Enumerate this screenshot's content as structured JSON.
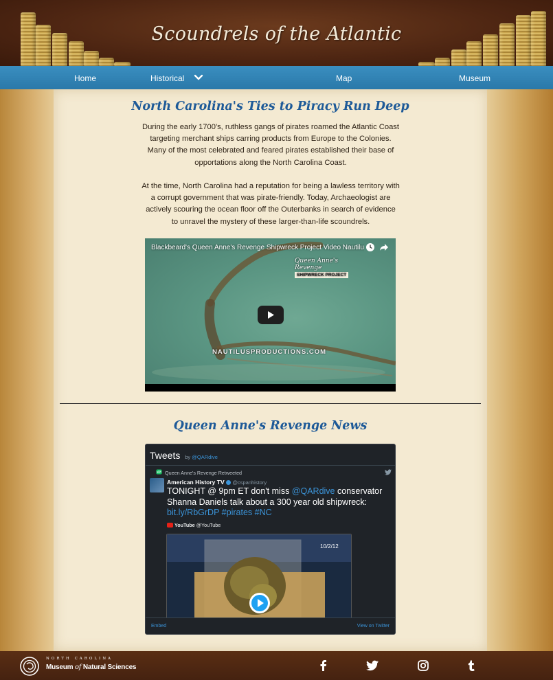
{
  "header": {
    "title": "Scoundrels of the Atlantic"
  },
  "nav": {
    "items": [
      "Home",
      "Historical",
      "Map",
      "Museum"
    ]
  },
  "main": {
    "heading": "North Carolina's Ties to Piracy Run Deep",
    "paragraphs": [
      "During the early 1700's, ruthless gangs of pirates roamed the Atlantic Coast targeting merchant ships carring products from Europe to the Colonies. Many of the most celebrated and feared pirates established their base of opportations along the North Carolina Coast.",
      "At the time, North Carolina had a reputation for being a lawless territory with a corrupt government that was pirate-friendly. Today, Archaeologist are actively scouring the ocean floor off the Outerbanks in search of evidence to unravel the mystery of these larger-than-life scoundrels."
    ],
    "video": {
      "title": "Blackbeard's Queen Anne's Revenge Shipwreck Project Video Nautilus Productions",
      "watermark": "NAUTILUSPRODUCTIONS.COM",
      "logo_text": "Queen Anne's Revenge",
      "logo_sub": "SHIPWRECK PROJECT"
    },
    "news_heading": "Queen Anne's Revenge News"
  },
  "tweets": {
    "title": "Tweets",
    "by": "by",
    "handle": "@QARdive",
    "retweet_label": "Queen Anne's Revenge Retweeted",
    "author_name": "American History TV",
    "author_handle": "@cspanhistory",
    "text_pre": "TONIGHT @ 9pm ET don't miss ",
    "text_mention": "@QARdive",
    "text_mid": " conservator Shanna Daniels talk about a 300 year old shipwreck: ",
    "text_link": "bit.ly/RbGrDP",
    "text_tags": "#pirates #NC",
    "media_source": "YouTube",
    "media_handle": "@YouTube",
    "media_date": "10/2/12",
    "embed_label": "Embed",
    "view_label": "View on Twitter"
  },
  "footer": {
    "museum_small": "NORTH CAROLINA",
    "museum_name_1": "Museum",
    "museum_name_of": "of",
    "museum_name_2": "Natural Sciences",
    "social_icons": [
      "facebook-icon",
      "twitter-icon",
      "instagram-icon",
      "tumblr-icon"
    ]
  },
  "colors": {
    "nav_blue": "#2a78a9",
    "heading_blue": "#1e5a98",
    "header_brown": "#4d2512",
    "twitter_link": "#3b94d9"
  }
}
